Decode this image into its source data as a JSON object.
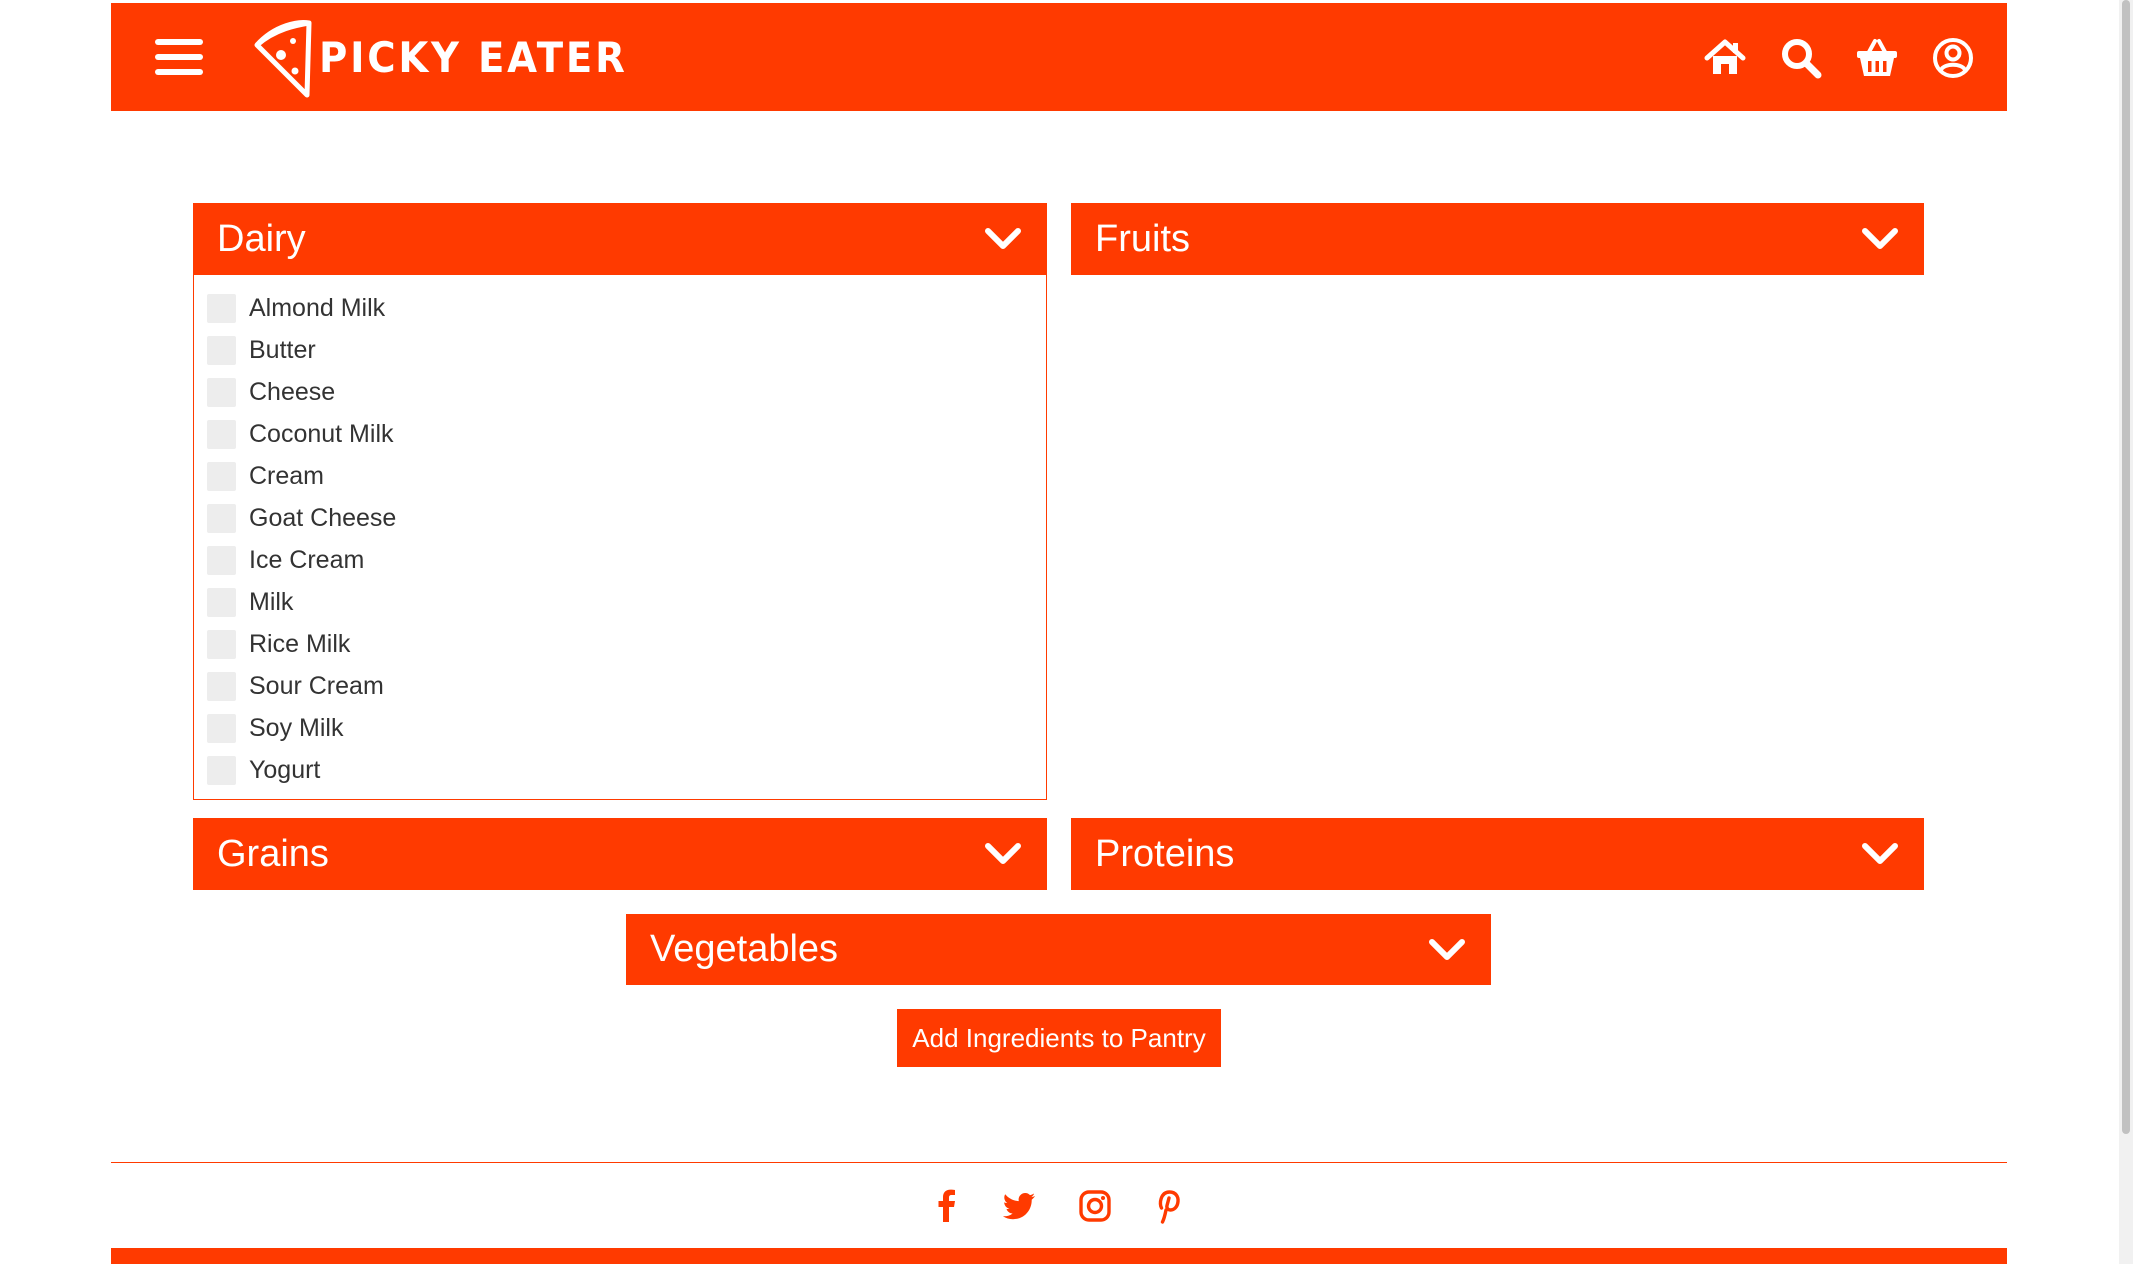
{
  "brand": {
    "name": "PICKY EATER",
    "color": "#ff3a00"
  },
  "header_icons": [
    "menu-icon",
    "home-icon",
    "search-icon",
    "basket-icon",
    "user-icon"
  ],
  "categories": {
    "dairy": {
      "title": "Dairy",
      "expanded": true,
      "items": [
        "Almond Milk",
        "Butter",
        "Cheese",
        "Coconut Milk",
        "Cream",
        "Goat Cheese",
        "Ice Cream",
        "Milk",
        "Rice Milk",
        "Sour Cream",
        "Soy Milk",
        "Yogurt"
      ]
    },
    "fruits": {
      "title": "Fruits",
      "expanded": false
    },
    "grains": {
      "title": "Grains",
      "expanded": false
    },
    "proteins": {
      "title": "Proteins",
      "expanded": false
    },
    "vegetables": {
      "title": "Vegetables",
      "expanded": false
    }
  },
  "actions": {
    "add_label": "Add Ingredients to Pantry"
  },
  "footer": {
    "social_icons": [
      "facebook-icon",
      "twitter-icon",
      "instagram-icon",
      "pinterest-icon"
    ]
  }
}
